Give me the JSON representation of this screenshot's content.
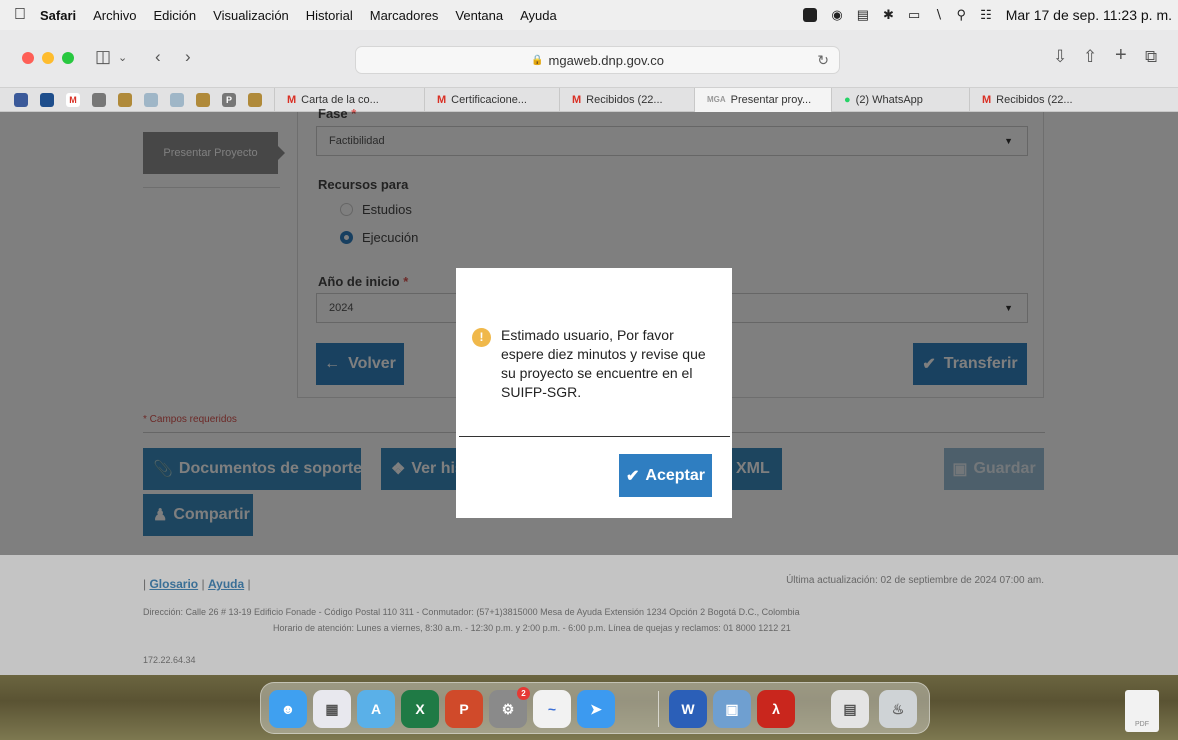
{
  "menubar": {
    "app": "Safari",
    "items": [
      "Archivo",
      "Edición",
      "Visualización",
      "Historial",
      "Marcadores",
      "Ventana",
      "Ayuda"
    ],
    "clock": "Mar 17 de sep.  11:23 p. m."
  },
  "toolbar": {
    "url": "mgaweb.dnp.gov.co"
  },
  "tabs": [
    {
      "label": "Carta de la co...",
      "icon": "gmail-icon"
    },
    {
      "label": "Certificacione...",
      "icon": "gmail-icon"
    },
    {
      "label": "Recibidos (22...",
      "icon": "gmail-icon"
    },
    {
      "label": "Presentar proy...",
      "icon": "mga-icon"
    },
    {
      "label": "(2) WhatsApp",
      "icon": "whatsapp-icon"
    },
    {
      "label": "Recibidos (22...",
      "icon": "gmail-icon"
    }
  ],
  "sidebar": {
    "presentar_label": "Presentar Proyecto"
  },
  "form": {
    "fase_label": "Fase",
    "fase_value": "Factibilidad",
    "recursos_label": "Recursos para",
    "option_estudios": "Estudios",
    "option_ejecucion": "Ejecución",
    "selected_option": "Ejecución",
    "anio_label": "Año de inicio",
    "anio_value": "2024",
    "required_mark": "*",
    "volver_label": "Volver",
    "transferir_label": "Transferir",
    "required_note": "* Campos requeridos"
  },
  "actions": {
    "documentos_label": "Documentos de soporte",
    "historial_label": "Ver his",
    "xml_label": "XML",
    "guardar_label": "Guardar",
    "compartir_label": "Compartir"
  },
  "modal": {
    "message": "Estimado usuario, Por favor espere diez minutos y revise que su proyecto se encuentre en el SUIFP-SGR.",
    "ok_label": "Aceptar"
  },
  "footer": {
    "glosario": "Glosario",
    "ayuda": "Ayuda",
    "updated": "Última actualización: 02 de septiembre de 2024 07:00 am.",
    "address": "Dirección: Calle 26 # 13-19 Edificio Fonade - Código Postal 110 311 - Conmutador: (57+1)3815000 Mesa de Ayuda Extensión 1234 Opción 2 Bogotá D.C., Colombia",
    "hours": "Horario de atención: Lunes a viernes, 8:30 a.m. - 12:30 p.m. y 2:00 p.m. - 6:00 p.m. Línea de quejas y reclamos: 01 8000 1212 21",
    "ip": "172.22.64.34"
  },
  "dock": {
    "settings_badge": "2"
  },
  "colors": {
    "primary": "#3382c1",
    "overlay": "rgba(0,0,0,0.5)",
    "warning": "#f0b84a",
    "required": "#d9534f"
  }
}
